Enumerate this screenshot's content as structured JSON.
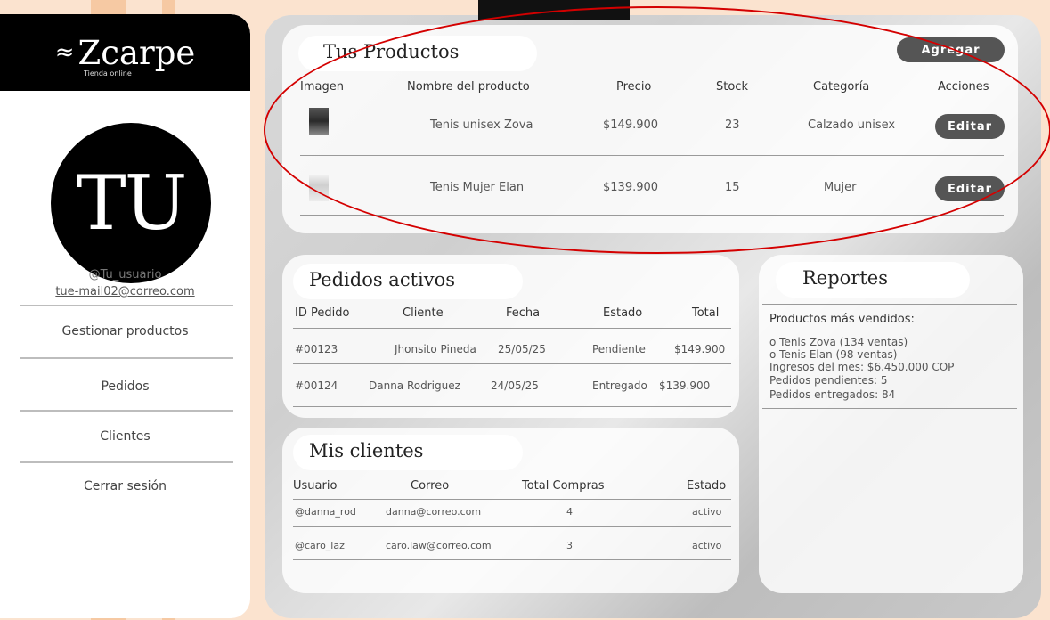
{
  "sidebar": {
    "brand_mark": "≈",
    "brand_name": "Zcarpe",
    "brand_sub": "Tienda online",
    "avatar_initials": "TU",
    "user_handle": "@Tu_usuario",
    "user_email": "tue-mail02@correo.com",
    "nav": [
      "Gestionar productos",
      "Pedidos",
      "Clientes",
      "Cerrar sesión"
    ]
  },
  "products": {
    "title": "Tus Productos",
    "add_label": "Agregar",
    "headers": [
      "Imagen",
      "Nombre del producto",
      "Precio",
      "Stock",
      "Categoría",
      "Acciones"
    ],
    "rows": [
      {
        "name": "Tenis unisex Zova",
        "price": "$149.900",
        "stock": "23",
        "category": "Calzado unisex",
        "action": "Editar"
      },
      {
        "name": "Tenis Mujer Elan",
        "price": "$139.900",
        "stock": "15",
        "category": "Mujer",
        "action": "Editar"
      }
    ]
  },
  "orders": {
    "title": "Pedidos activos",
    "headers": [
      "ID Pedido",
      "Cliente",
      "Fecha",
      "Estado",
      "Total"
    ],
    "rows": [
      {
        "id": "#00123",
        "client": "Jhonsito Pineda",
        "date": "25/05/25",
        "status": "Pendiente",
        "total": "$149.900"
      },
      {
        "id": "#00124",
        "client": "Danna Rodriguez",
        "date": "24/05/25",
        "status": "Entregado",
        "total": "$139.900"
      }
    ]
  },
  "clients": {
    "title": "Mis clientes",
    "headers": [
      "Usuario",
      "Correo",
      "Total Compras",
      "Estado"
    ],
    "rows": [
      {
        "user": "@danna_rod",
        "email": "danna@correo.com",
        "purchases": "4",
        "status": "activo"
      },
      {
        "user": "@caro_laz",
        "email": "caro.law@correo.com",
        "purchases": "3",
        "status": "activo"
      }
    ]
  },
  "reports": {
    "title": "Reportes",
    "subtitle": "Productos más vendidos:",
    "lines": [
      "o Tenis Zova (134 ventas)",
      "o Tenis Elan (98 ventas)",
      "Ingresos del mes: $6.450.000 COP",
      "Pedidos pendientes: 5",
      "Pedidos entregados: 84"
    ]
  },
  "colors": {
    "background": "#fbe3cf",
    "sidebar": "#ffffff",
    "brand_bg": "#000000",
    "button": "#555555",
    "annotation": "#d40000"
  }
}
